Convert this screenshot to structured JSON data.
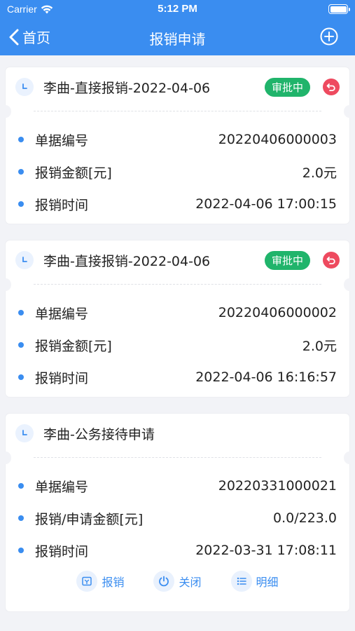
{
  "status": {
    "carrier": "Carrier",
    "time": "5:12 PM"
  },
  "nav": {
    "back_label": "首页",
    "title": "报销申请"
  },
  "cards": [
    {
      "title": "李曲-直接报销-2022-04-06",
      "badge": "审批中",
      "rows": [
        {
          "label": "单据编号",
          "value": "20220406000003"
        },
        {
          "label": "报销金额[元]",
          "value": "2.0元"
        },
        {
          "label": "报销时间",
          "value": "2022-04-06 17:00:15"
        }
      ]
    },
    {
      "title": "李曲-直接报销-2022-04-06",
      "badge": "审批中",
      "rows": [
        {
          "label": "单据编号",
          "value": "20220406000002"
        },
        {
          "label": "报销金额[元]",
          "value": "2.0元"
        },
        {
          "label": "报销时间",
          "value": "2022-04-06 16:16:57"
        }
      ]
    },
    {
      "title": "李曲-公务接待申请",
      "rows": [
        {
          "label": "单据编号",
          "value": "20220331000021"
        },
        {
          "label": "报销/申请金额[元]",
          "value": "0.0/223.0"
        },
        {
          "label": "报销时间",
          "value": "2022-03-31 17:08:11"
        }
      ],
      "actions": [
        {
          "label": "报销",
          "icon": "reimburse-icon"
        },
        {
          "label": "关闭",
          "icon": "power-icon"
        },
        {
          "label": "明细",
          "icon": "list-icon"
        }
      ]
    }
  ],
  "colors": {
    "primary": "#3a8df0",
    "badge_green": "#20b46b",
    "revoke_red": "#ee4a5f"
  }
}
